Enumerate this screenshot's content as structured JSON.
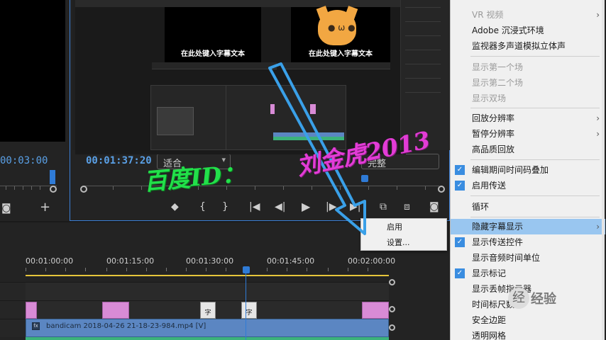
{
  "source_monitor": {
    "timecode": "00:03:00"
  },
  "program_monitor": {
    "timecode": "00:01:37:20",
    "fit_label": "适合",
    "resolution_label": "完整",
    "controls": {
      "mark_in": "◆",
      "step_back_mark": "{",
      "step_forward_mark": "}",
      "go_in": "|◀",
      "step_back": "◀|",
      "play": "▶",
      "step_forward": "|▶",
      "go_out": "▶|",
      "lift": "⧉",
      "extract": "⧈",
      "export_frame": "◙"
    },
    "inner": {
      "subtitle_left": "在此处键入字幕文本",
      "subtitle_right": "在此处键入字幕文本"
    }
  },
  "timeline": {
    "ruler_labels": [
      "00:01:00:00",
      "00:01:15:00",
      "00:01:30:00",
      "00:01:45:00",
      "00:02:00:00"
    ],
    "video_clip_label": "bandicam 2018-04-26 21-18-23-984.mp4 [V]",
    "clip_marker_text": "字"
  },
  "context_menu": {
    "items": [
      {
        "label": "VR 视频",
        "disabled": true,
        "submenu": true
      },
      {
        "label": "Adobe 沉浸式环境",
        "disabled": false
      },
      {
        "label": "监视器多声道模拟立体声",
        "disabled": false
      },
      {
        "label": "显示第一个场",
        "disabled": true
      },
      {
        "label": "显示第二个场",
        "disabled": true
      },
      {
        "label": "显示双场",
        "disabled": true
      },
      {
        "label": "回放分辨率",
        "disabled": false,
        "submenu": true
      },
      {
        "label": "暂停分辨率",
        "disabled": false,
        "submenu": true
      },
      {
        "label": "高品质回放",
        "disabled": false
      },
      {
        "label": "编辑期间时间码叠加",
        "disabled": false,
        "checked": true
      },
      {
        "label": "启用传送",
        "disabled": false,
        "checked": true
      },
      {
        "label": "循环",
        "disabled": false
      },
      {
        "label": "隐藏字幕显示",
        "disabled": false,
        "submenu": true,
        "highlighted": true
      },
      {
        "label": "显示传送控件",
        "disabled": false,
        "checked": true
      },
      {
        "label": "显示音频时间单位",
        "disabled": false
      },
      {
        "label": "显示标记",
        "disabled": false,
        "checked": true
      },
      {
        "label": "显示丢帧指示器",
        "disabled": false
      },
      {
        "label": "时间标尺数字",
        "disabled": false
      },
      {
        "label": "安全边距",
        "disabled": false
      },
      {
        "label": "透明网格",
        "disabled": false
      }
    ],
    "check_mark": "✓",
    "submenu_arrow": "›"
  },
  "submenu": {
    "items": [
      "启用",
      "设置..."
    ]
  },
  "watermark": {
    "green_text": "百度ID：",
    "pink_text": "刘金虎2013"
  },
  "badge": {
    "icon_text": "经",
    "text": "经验"
  },
  "colors": {
    "accent_blue": "#2f7bd6",
    "timecode_blue": "#5aa0e6",
    "clip_pink": "#d88bd6",
    "clip_video": "#5b86c2",
    "check_blue": "#3a8de0",
    "menu_highlight": "#99c6f0",
    "watermark_green": "#22e04a",
    "watermark_pink": "#e23cd6",
    "arrow_blue": "#3aa0e8"
  }
}
